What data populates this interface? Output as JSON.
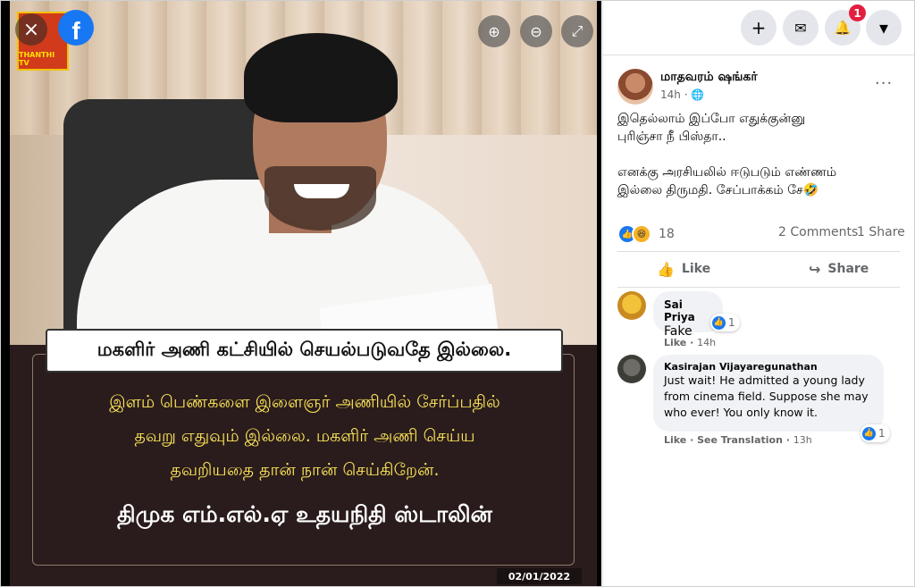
{
  "viewer": {
    "close_icon": "×",
    "fb_letter": "f",
    "thanthi_label": "THANTHI TV",
    "zoom_in_icon": "⊕",
    "zoom_out_icon": "⊖",
    "fullscreen_icon": "⤢",
    "headline": "மகளிர் அணி கட்சியில் செயல்படுவதே இல்லை.",
    "quote_lines": [
      "இளம் பெண்களை இளைஞர் அணியில் சேர்ப்பதில்",
      "தவறு எதுவும் இல்லை. மகளிர் அணி செய்ய",
      "தவறியதை தான் நான் செய்கிறேன்."
    ],
    "byline": "திமுக எம்.எல்.ஏ உதயநிதி ஸ்டாலின்",
    "date": "02/01/2022"
  },
  "topbar": {
    "create_icon": "+",
    "messenger_icon": "✉",
    "notifications_icon": "🔔",
    "notifications_count": "1",
    "menu_icon": "▾"
  },
  "post": {
    "author": "மாதவரம் ஷங்கர்",
    "time": "14h · 🌐",
    "more_icon": "···",
    "text": "இதெல்லாம் இப்போ எதுக்குன்னு\nபுரிஞ்சா நீ பிஸ்தா..\n\nஎனக்கு அரசியலில் ஈடுபடும் எண்ணம்\nஇல்லை திருமதி. சேப்பாக்கம் சே🤣",
    "reaction_count": "18",
    "comments_count": "2 Comments",
    "shares_count": "1 Share",
    "like_label": "Like",
    "share_label": "Share",
    "like_icon": "👍",
    "share_icon": "↪"
  },
  "comments": [
    {
      "name": "Sai Priya",
      "text": "Fake",
      "like_label": "Like",
      "time": "14h",
      "reactions": "1"
    },
    {
      "name": "Kasirajan Vijayaregunathan",
      "text": "Just wait! He admitted a young lady from cinema field. Suppose she may who ever! You only know it.",
      "like_label": "Like",
      "translation_label": "See Translation",
      "time": "13h",
      "reactions": "1"
    }
  ],
  "colors": {
    "fb_blue": "#1877f2",
    "badge_red": "#e41e3f",
    "quote_yellow": "#ffe85a",
    "panel_dark": "#2a1c1c"
  }
}
